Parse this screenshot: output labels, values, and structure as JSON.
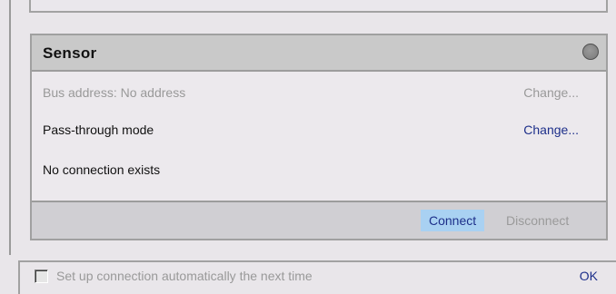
{
  "sensor": {
    "title": "Sensor",
    "bus_address": "Bus address: No address",
    "bus_change": "Change...",
    "mode": "Pass-through mode",
    "mode_change": "Change...",
    "connection_status": "No connection exists",
    "connect_label": "Connect",
    "disconnect_label": "Disconnect",
    "status_light": "status-indicator-icon"
  },
  "footer": {
    "auto_connect_label": "Set up connection automatically the next time",
    "ok_label": "OK"
  }
}
